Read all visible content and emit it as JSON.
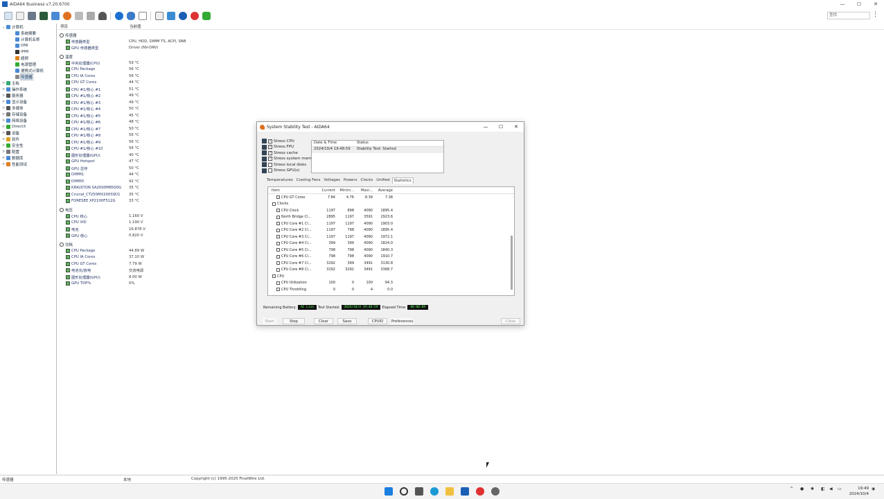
{
  "window": {
    "title": "AIDA64 Business v7.20.6700",
    "min": "—",
    "max": "☐",
    "close": "✕"
  },
  "search": {
    "placeholder": "查找"
  },
  "tree": [
    {
      "label": "计算机",
      "lvl": 0,
      "exp": "⌄",
      "color": "#4a8ad4"
    },
    {
      "label": "系统摘要",
      "lvl": 1,
      "exp": "",
      "color": "#4a8ad4"
    },
    {
      "label": "计算机名称",
      "lvl": 1,
      "exp": "",
      "color": "#4a8ad4"
    },
    {
      "label": "DMI",
      "lvl": 1,
      "exp": "",
      "color": "#4a8ad4"
    },
    {
      "label": "IPMI",
      "lvl": 1,
      "exp": "",
      "color": "#333"
    },
    {
      "label": "超频",
      "lvl": 1,
      "exp": "",
      "color": "#e08020"
    },
    {
      "label": "电源管理",
      "lvl": 1,
      "exp": "",
      "color": "#3a3"
    },
    {
      "label": "便携式计算机",
      "lvl": 1,
      "exp": "",
      "color": "#4a8ad4"
    },
    {
      "label": "传感器",
      "lvl": 1,
      "exp": "",
      "color": "#888",
      "sel": true
    },
    {
      "label": "主板",
      "lvl": 0,
      "exp": ">",
      "color": "#3a7"
    },
    {
      "label": "操作系统",
      "lvl": 0,
      "exp": ">",
      "color": "#4a8ad4"
    },
    {
      "label": "服务器",
      "lvl": 0,
      "exp": ">",
      "color": "#555"
    },
    {
      "label": "显示设备",
      "lvl": 0,
      "exp": ">",
      "color": "#4a8ad4"
    },
    {
      "label": "多媒体",
      "lvl": 0,
      "exp": ">",
      "color": "#555"
    },
    {
      "label": "存储设备",
      "lvl": 0,
      "exp": ">",
      "color": "#777"
    },
    {
      "label": "网络设备",
      "lvl": 0,
      "exp": ">",
      "color": "#4a8ad4"
    },
    {
      "label": "DirectX",
      "lvl": 0,
      "exp": ">",
      "color": "#3a3"
    },
    {
      "label": "设备",
      "lvl": 0,
      "exp": ">",
      "color": "#555"
    },
    {
      "label": "软件",
      "lvl": 0,
      "exp": ">",
      "color": "#e0a020"
    },
    {
      "label": "安全性",
      "lvl": 0,
      "exp": ">",
      "color": "#3a3"
    },
    {
      "label": "配置",
      "lvl": 0,
      "exp": ">",
      "color": "#777"
    },
    {
      "label": "数据库",
      "lvl": 0,
      "exp": ">",
      "color": "#4a8ad4"
    },
    {
      "label": "性能测试",
      "lvl": 0,
      "exp": ">",
      "color": "#e08020"
    }
  ],
  "main": {
    "col_item": "项目",
    "col_value": "当前值",
    "sections": [
      {
        "title": "传感器",
        "rows": [
          {
            "k": "传感器类型",
            "v": "CPU, HDD, DIMM TS, ACPI, SNB"
          },
          {
            "k": "GPU 传感器类型",
            "v": "Driver (NV-DRV)"
          }
        ]
      },
      {
        "title": "温度",
        "rows": [
          {
            "k": "中央处理器(CPU)",
            "v": "59 °C"
          },
          {
            "k": "CPU Package",
            "v": "56 °C"
          },
          {
            "k": "CPU IA Cores",
            "v": "56 °C"
          },
          {
            "k": "CPU GT Cores",
            "v": "44 °C"
          },
          {
            "k": "CPU #1/核心 #1",
            "v": "51 °C"
          },
          {
            "k": "CPU #1/核心 #2",
            "v": "49 °C"
          },
          {
            "k": "CPU #1/核心 #3",
            "v": "49 °C"
          },
          {
            "k": "CPU #1/核心 #4",
            "v": "50 °C"
          },
          {
            "k": "CPU #1/核心 #5",
            "v": "45 °C"
          },
          {
            "k": "CPU #1/核心 #6",
            "v": "48 °C"
          },
          {
            "k": "CPU #1/核心 #7",
            "v": "50 °C"
          },
          {
            "k": "CPU #1/核心 #8",
            "v": "56 °C"
          },
          {
            "k": "CPU #1/核心 #9",
            "v": "56 °C"
          },
          {
            "k": "CPU #1/核心 #10",
            "v": "56 °C"
          },
          {
            "k": "图形处理器(GPU)",
            "v": "40 °C"
          },
          {
            "k": "GPU Hotspot",
            "v": "47 °C"
          },
          {
            "k": "GPU 显存",
            "v": "50 °C"
          },
          {
            "k": "DIMM1",
            "v": "44 °C"
          },
          {
            "k": "DIMM3",
            "v": "42 °C"
          },
          {
            "k": "KINGSTON SA2000M8500G",
            "v": "35 °C"
          },
          {
            "k": "Crucial_CT250MX200SSD1",
            "v": "35 °C"
          },
          {
            "k": "FORESEE XP2100F512G",
            "v": "33 °C"
          }
        ]
      },
      {
        "title": "电压",
        "rows": [
          {
            "k": "CPU 核心",
            "v": "1.160 V"
          },
          {
            "k": "CPU VID",
            "v": "1.190 V"
          },
          {
            "k": "电池",
            "v": "16.878 V"
          },
          {
            "k": "GPU 核心",
            "v": "0.820 V"
          }
        ]
      },
      {
        "title": "功耗",
        "rows": [
          {
            "k": "CPU Package",
            "v": "44.89 W"
          },
          {
            "k": "CPU IA Cores",
            "v": "37.10 W"
          },
          {
            "k": "CPU GT Cores",
            "v": "7.79 W"
          },
          {
            "k": "电池充/放电",
            "v": "交流电源"
          },
          {
            "k": "图形处理器(GPU)",
            "v": "8.00 W"
          },
          {
            "k": "GPU TDP%",
            "v": "0%"
          }
        ]
      }
    ]
  },
  "dialog": {
    "title": "System Stability Test - AIDA64",
    "checks": [
      {
        "label": "Stress CPU",
        "checked": true
      },
      {
        "label": "Stress FPU",
        "checked": true
      },
      {
        "label": "Stress cache",
        "checked": true
      },
      {
        "label": "Stress system memory",
        "checked": true
      },
      {
        "label": "Stress local disks",
        "checked": false
      },
      {
        "label": "Stress GPU(s)",
        "checked": false
      }
    ],
    "log": {
      "h_date": "Date & Time",
      "h_status": "Status",
      "date": "2024/10/4 19:48:59",
      "status": "Stability Test: Started"
    },
    "tabs": [
      "Temperatures",
      "Cooling Fans",
      "Voltages",
      "Powers",
      "Clocks",
      "Unified",
      "Statistics"
    ],
    "stats": {
      "headers": [
        "Item",
        "Current",
        "Minim...",
        "Maxi...",
        "Average"
      ],
      "rows": [
        {
          "n": "CPU GT Cores",
          "a": "7.84",
          "b": "4.76",
          "c": "8.39",
          "d": "7.38",
          "ind": 2
        },
        {
          "n": "Clocks",
          "a": "",
          "b": "",
          "c": "",
          "d": "",
          "ind": 1
        },
        {
          "n": "CPU Clock",
          "a": "1197",
          "b": "898",
          "c": "4090",
          "d": "1895.4",
          "ind": 2
        },
        {
          "n": "North Bridge Cl...",
          "a": "2895",
          "b": "1197",
          "c": "3591",
          "d": "2923.6",
          "ind": 2
        },
        {
          "n": "CPU Core #1 Cl...",
          "a": "1197",
          "b": "1197",
          "c": "4090",
          "d": "1903.0",
          "ind": 2
        },
        {
          "n": "CPU Core #2 Cl...",
          "a": "1197",
          "b": "798",
          "c": "4090",
          "d": "1895.4",
          "ind": 2
        },
        {
          "n": "CPU Core #3 Cl...",
          "a": "1197",
          "b": "1197",
          "c": "4090",
          "d": "1972.1",
          "ind": 2
        },
        {
          "n": "CPU Core #4 Cl...",
          "a": "399",
          "b": "399",
          "c": "4090",
          "d": "1824.0",
          "ind": 2
        },
        {
          "n": "CPU Core #5 Cl...",
          "a": "798",
          "b": "798",
          "c": "4090",
          "d": "1840.3",
          "ind": 2
        },
        {
          "n": "CPU Core #6 Cl...",
          "a": "798",
          "b": "798",
          "c": "4090",
          "d": "1910.7",
          "ind": 2
        },
        {
          "n": "CPU Core #7 Cl...",
          "a": "3292",
          "b": "399",
          "c": "3491",
          "d": "3130.8",
          "ind": 2
        },
        {
          "n": "CPU Core #8 Cl...",
          "a": "3292",
          "b": "3292",
          "c": "3491",
          "d": "3368.7",
          "ind": 2
        },
        {
          "n": "CPU",
          "a": "",
          "b": "",
          "c": "",
          "d": "",
          "ind": 1
        },
        {
          "n": "CPU Utilization",
          "a": "100",
          "b": "0",
          "c": "100",
          "d": "94.3",
          "ind": 2
        },
        {
          "n": "CPU Throttling",
          "a": "0",
          "b": "0",
          "c": "4",
          "d": "0.0",
          "ind": 2
        }
      ]
    },
    "battery_label": "Remaining Battery:",
    "battery_value": "AC Line",
    "started_label": "Test Started:",
    "started_value": "2024/10/4 19:48:59",
    "elapsed_label": "Elapsed Time:",
    "elapsed_value": "00:00:09",
    "buttons": {
      "start": "Start",
      "stop": "Stop",
      "clear": "Clear",
      "save": "Save",
      "cpuid": "CPUID",
      "pref": "Preferences",
      "close": "Close"
    }
  },
  "status": {
    "left": "传感器",
    "mid": "本地",
    "copyright": "Copyright (c) 1995-2025 FinalWire Ltd."
  },
  "clock": {
    "time": "19:49",
    "date": "2024/10/4"
  }
}
